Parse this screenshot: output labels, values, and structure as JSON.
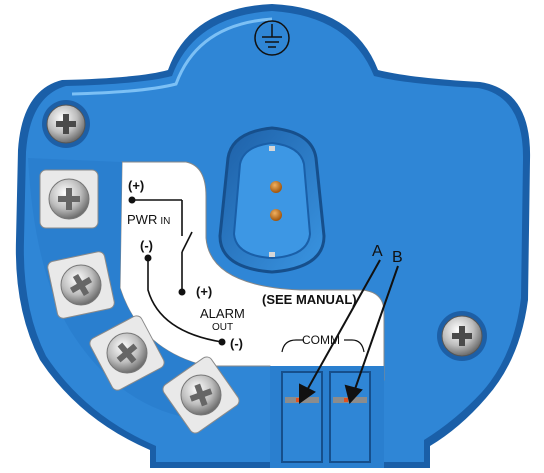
{
  "colors": {
    "housing": "#2f86d6",
    "housing_dark": "#1a5fa8",
    "housing_light": "#64aef0",
    "panel": "#ffffff",
    "screw": "#c9c9c9",
    "pin": "#c8781d",
    "ink": "#111111"
  },
  "icons": [
    "ground-icon",
    "screw-icon",
    "terminal-screw-icon",
    "connector-pin-icon",
    "arrow-icon"
  ],
  "labels": {
    "pwr_plus": "(+)",
    "pwr_in_main": "PWR",
    "pwr_in_sub": "IN",
    "pwr_minus": "(-)",
    "alarm_plus": "(+)",
    "alarm_main": "ALARM",
    "alarm_sub": "OUT",
    "alarm_minus": "(-)",
    "see_manual": "(SEE MANUAL)",
    "comm": "COMM",
    "callout_a": "A",
    "callout_b": "B"
  }
}
